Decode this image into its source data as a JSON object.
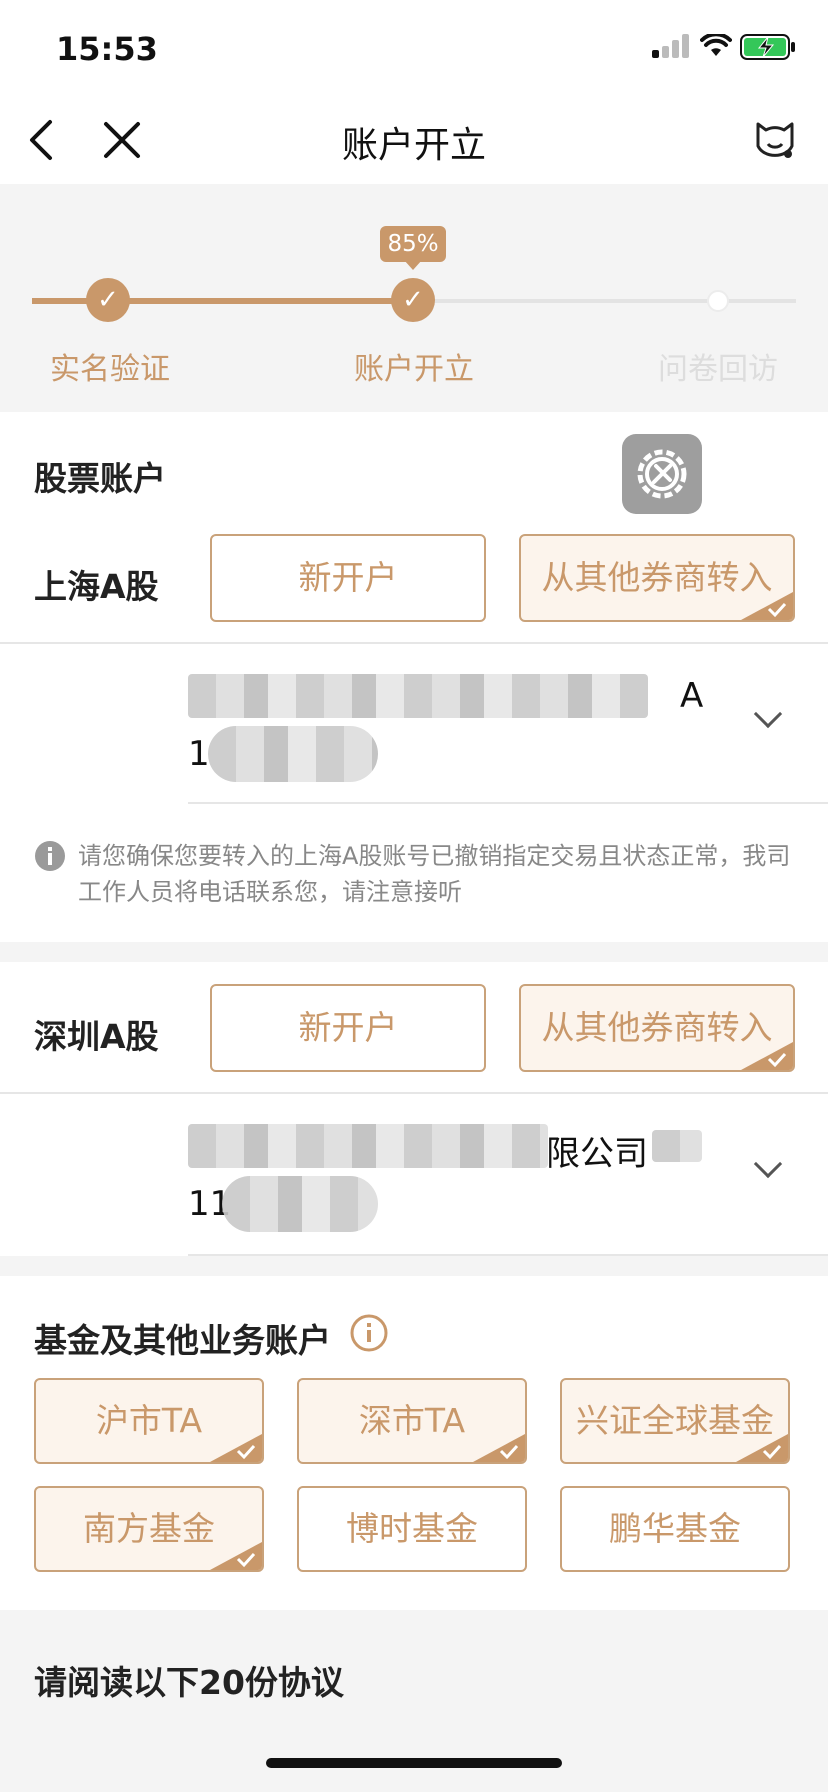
{
  "status": {
    "time": "15:53"
  },
  "nav": {
    "title": "账户开立"
  },
  "progress": {
    "percent_label": "85%",
    "percent": 85,
    "steps": [
      {
        "label": "实名验证",
        "state": "done"
      },
      {
        "label": "账户开立",
        "state": "current"
      },
      {
        "label": "问卷回访",
        "state": "todo"
      }
    ]
  },
  "stock": {
    "title": "股票账户",
    "sh": {
      "label": "上海A股",
      "new_label": "新开户",
      "transfer_label": "从其他券商转入",
      "selected": "transfer",
      "broker_suffix": "A",
      "account_prefix": "1",
      "note": "请您确保您要转入的上海A股账号已撤销指定交易且状态正常，我司工作人员将电话联系您，请注意接听"
    },
    "sz": {
      "label": "深圳A股",
      "new_label": "新开户",
      "transfer_label": "从其他券商转入",
      "selected": "transfer",
      "broker_suffix": "限公司",
      "account_prefix": "11"
    }
  },
  "fund": {
    "title": "基金及其他业务账户",
    "items": [
      {
        "label": "沪市TA",
        "selected": true
      },
      {
        "label": "深市TA",
        "selected": true
      },
      {
        "label": "兴证全球基金",
        "selected": true
      },
      {
        "label": "南方基金",
        "selected": true
      },
      {
        "label": "博时基金",
        "selected": false
      },
      {
        "label": "鹏华基金",
        "selected": false
      }
    ]
  },
  "agreements": {
    "title": "请阅读以下20份协议"
  },
  "colors": {
    "accent": "#c9986a",
    "accent_light": "#fcf4ec",
    "border": "#c9a27a"
  }
}
